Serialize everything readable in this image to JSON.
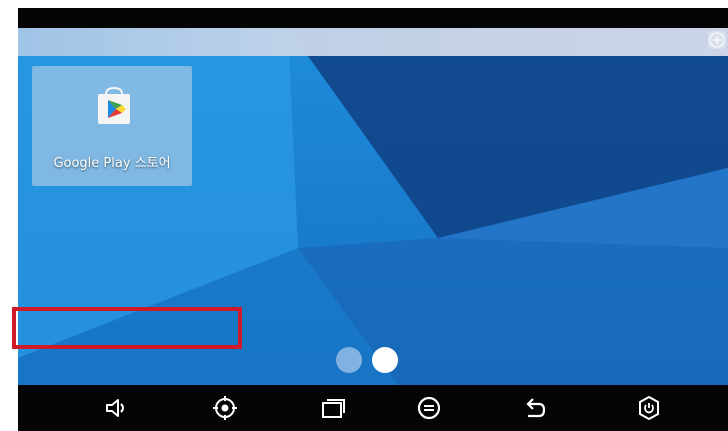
{
  "desktop": {
    "apps": [
      {
        "label": "Google Play 스토어",
        "icon": "play-store-icon"
      }
    ]
  },
  "pages": {
    "count": 2,
    "active_index": 2
  },
  "nav_bar": {
    "buttons": [
      {
        "name": "volume-icon"
      },
      {
        "name": "screenshot-icon"
      },
      {
        "name": "recent-apps-icon"
      },
      {
        "name": "home-icon"
      },
      {
        "name": "back-icon"
      },
      {
        "name": "power-icon"
      }
    ]
  },
  "colors": {
    "highlight": "#d01a2a",
    "nav_background": "#050505",
    "wallpaper": "#1b7fd0"
  }
}
